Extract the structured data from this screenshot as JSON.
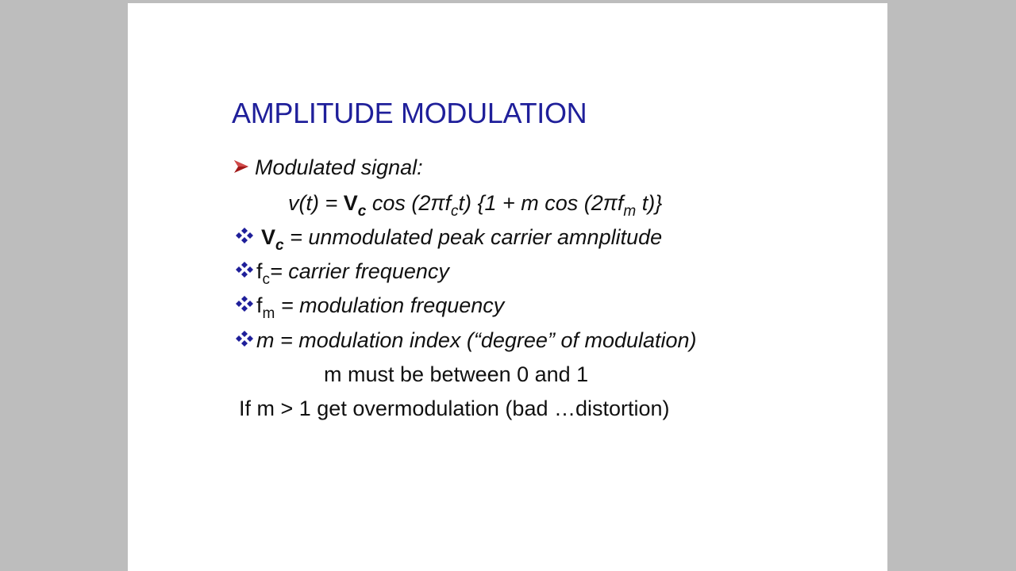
{
  "title": "AMPLITUDE MODULATION",
  "heading": "Modulated signal:",
  "equation": {
    "p1": "v(t) = ",
    "v": "V",
    "c1": "c",
    "p2": " cos (2πf",
    "c2": "c",
    "p3": "t) {1 + m cos (2πf",
    "m": "m",
    "p4": " t)}"
  },
  "def_vc": {
    "sym": "V",
    "sub": "c",
    "text": " = unmodulated peak carrier amnplitude"
  },
  "def_fc": {
    "sym": "f",
    "sub": "c",
    "text": "= carrier frequency"
  },
  "def_fm": {
    "sym": "f",
    "sub": "m",
    "text": " = modulation frequency"
  },
  "def_m": {
    "text": "m = modulation index (“degree” of modulation)"
  },
  "note1": "m must be between 0 and 1",
  "note2": "If m > 1 get overmodulation (bad …distortion)",
  "colors": {
    "title": "#1f1f9a",
    "arrow": "#a01818",
    "diamond": "#1f1f9a",
    "text": "#111111",
    "frame": "#bdbdbd"
  },
  "icons": {
    "heading_bullet": "arrow-bullet-icon",
    "definition_bullet": "diamond-cluster-bullet-icon"
  }
}
